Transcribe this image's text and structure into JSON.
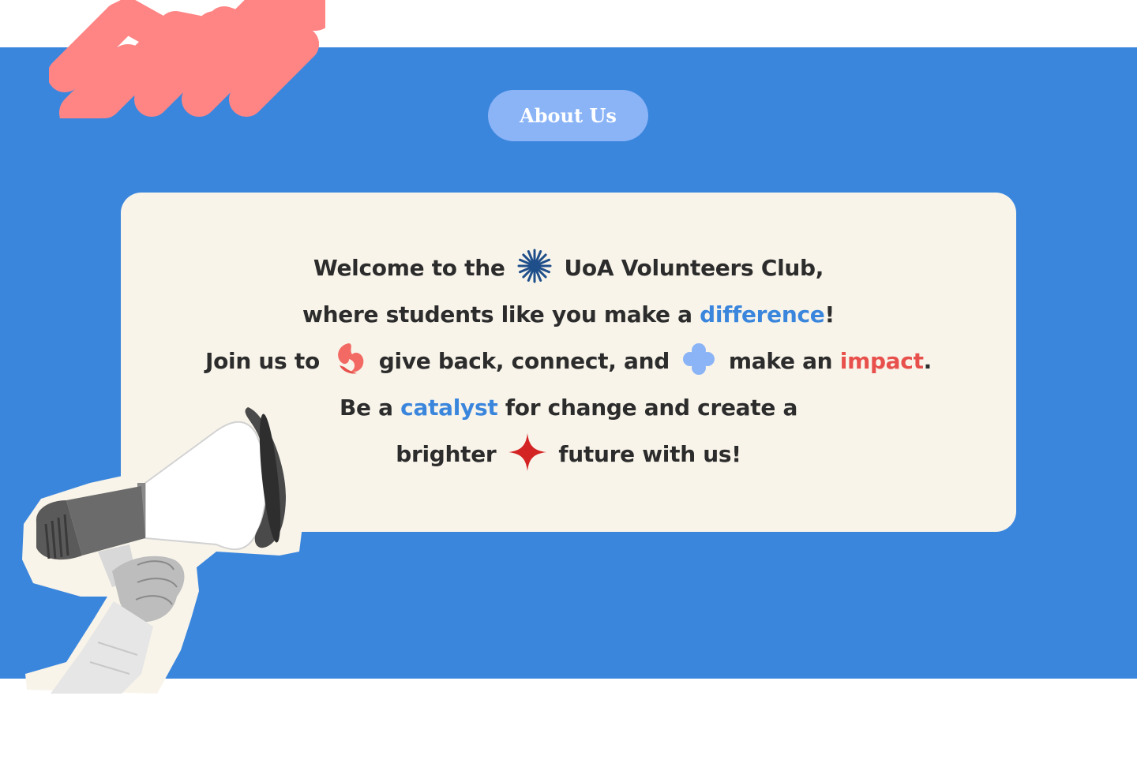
{
  "header": {
    "about_label": "About Us"
  },
  "intro": {
    "line1_a": "Welcome to the",
    "line1_b": "UoA Volunteers Club,",
    "line2_a": "where students like you make a",
    "line2_highlight": "difference",
    "line2_b": "!",
    "line3_a": "Join us to",
    "line3_b": "give back, connect, and",
    "line3_c": "make an",
    "line3_highlight": "impact",
    "line3_d": ".",
    "line4_a": "Be a",
    "line4_highlight": "catalyst",
    "line4_b": "for change and create a",
    "line5_a": "brighter",
    "line5_b": "future with us!"
  },
  "icons": {
    "starburst": "starburst-icon",
    "swirl": "swirl-icon",
    "clover": "clover-icon",
    "sparkle": "sparkle-icon",
    "megaphone": "megaphone-icon",
    "squiggle": "squiggle-decoration"
  },
  "colors": {
    "section_background": "#3b86dd",
    "card_background": "#f8f4ea",
    "pill_background": "#8bb4f7",
    "accent_blue": "#3b86dd",
    "accent_red": "#e8504c",
    "squiggle": "#ff8585",
    "text": "#2c2c2c"
  }
}
